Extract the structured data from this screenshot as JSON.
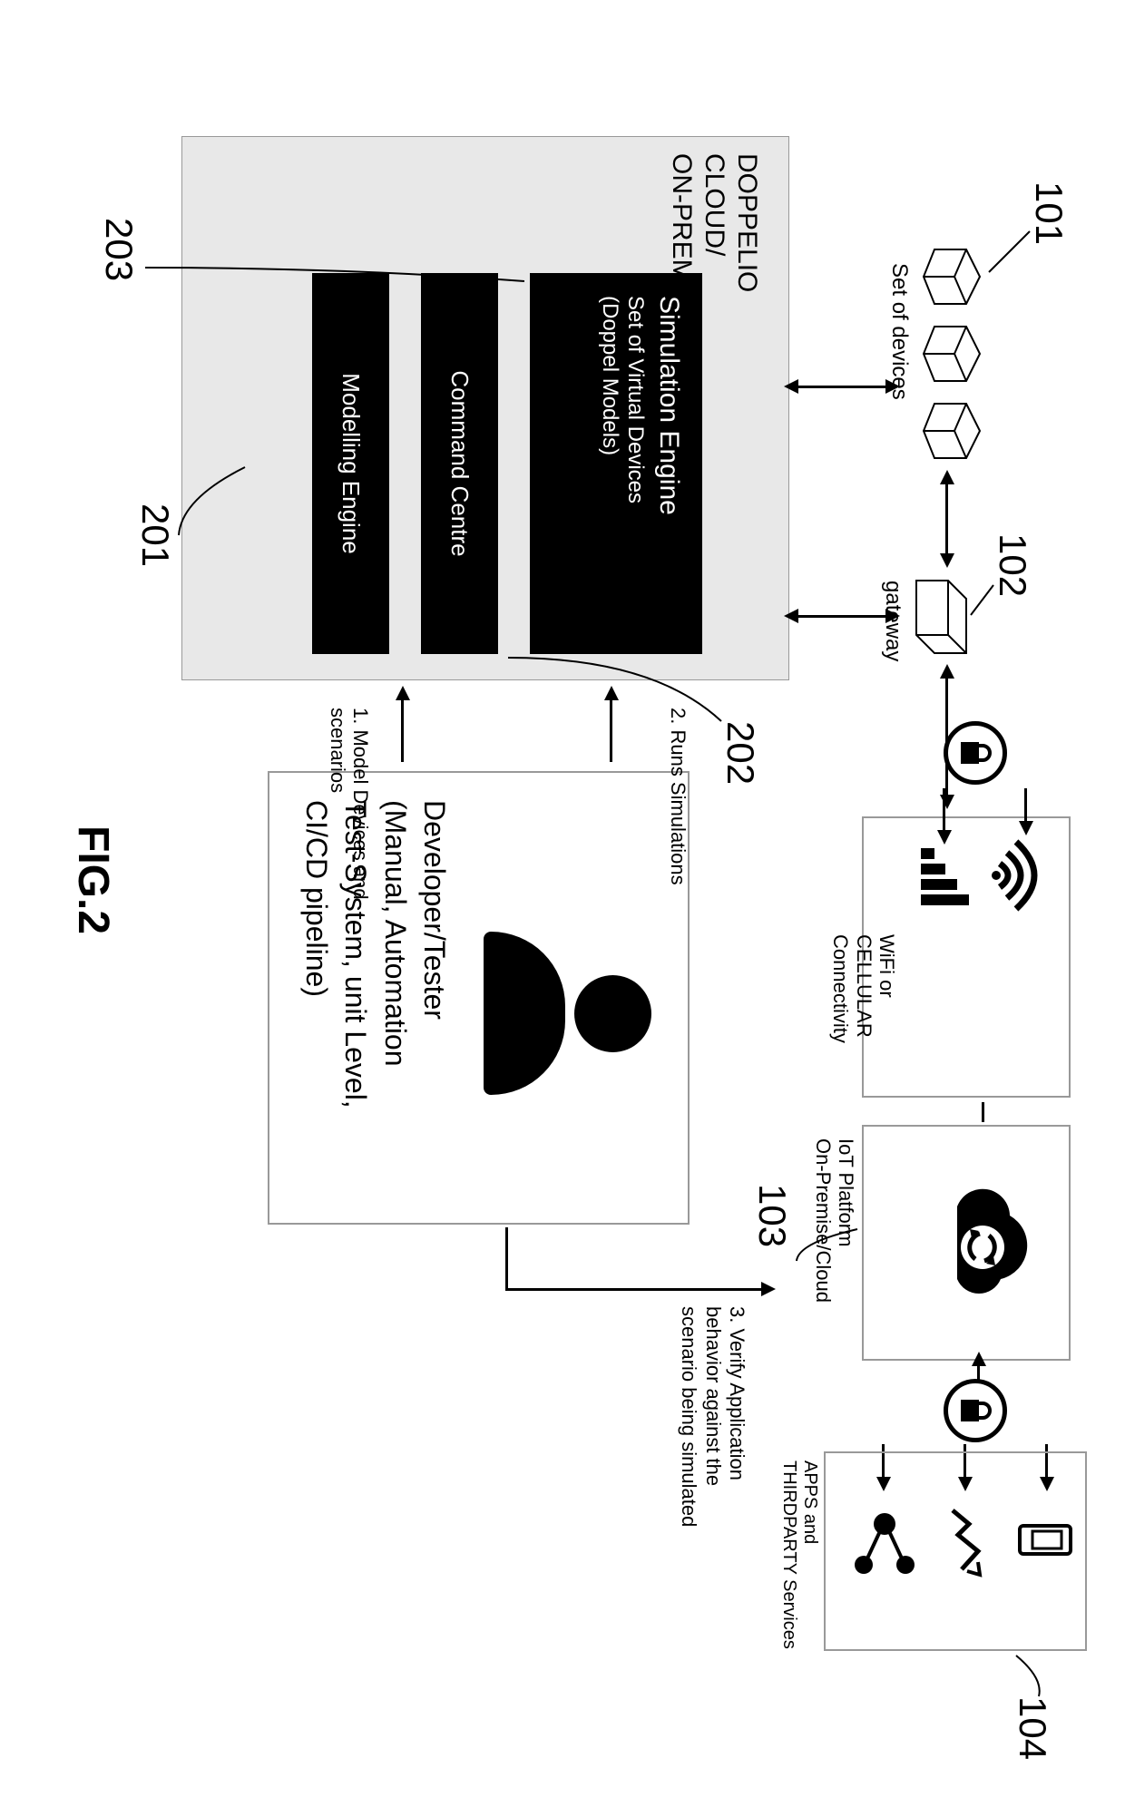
{
  "figure_label": "FIG.2",
  "refs": {
    "r101": "101",
    "r102": "102",
    "r103": "103",
    "r104": "104",
    "r201": "201",
    "r202": "202",
    "r203": "203"
  },
  "doppelio": {
    "title_l1": "DOPPELIO",
    "title_l2": "CLOUD/",
    "title_l3": "ON-PREM",
    "sim_engine_title": "Simulation Engine",
    "sim_engine_sub1": "Set of Virtual Devices",
    "sim_engine_sub2": "(Doppel Models)",
    "command_centre": "Command Centre",
    "modelling_engine": "Modelling Engine"
  },
  "top": {
    "set_of_devices": "Set of devices",
    "gateway": "gateway",
    "conn_l1": "WiFi or",
    "conn_l2": "CELLULAR",
    "conn_l3": "Connectivity",
    "iot_l1": "IoT Platform",
    "iot_l2": "On-Premise/Cloud",
    "apps_l1": "APPS and",
    "apps_l2": "THIRDPARTY Services"
  },
  "developer": {
    "line1": "Developer/Tester",
    "line2": "(Manual, Automation",
    "line3": "Test-System, unit Level,",
    "line4": "CI/CD pipeline)"
  },
  "flows": {
    "step1_l1": "1. Model Devices and",
    "step1_l2": "scenarios",
    "step2": "2. Runs Simulations",
    "step3_l1": "3. Verify Application",
    "step3_l2": "behavior against the",
    "step3_l3": "scenario being simulated"
  }
}
